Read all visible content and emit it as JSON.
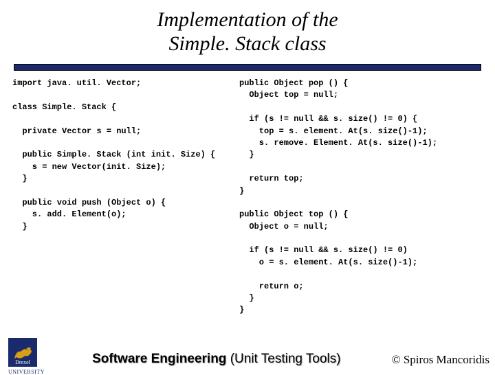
{
  "title_line1": "Implementation of the",
  "title_line2": "Simple. Stack class",
  "code_left": "import java. util. Vector;\n\nclass Simple. Stack {\n\n  private Vector s = null;\n\n  public Simple. Stack (int init. Size) {\n    s = new Vector(init. Size);\n  }\n\n  public void push (Object o) {\n    s. add. Element(o);\n  }",
  "code_right": "public Object pop () {\n  Object top = null;\n\n  if (s != null && s. size() != 0) {\n    top = s. element. At(s. size()-1);\n    s. remove. Element. At(s. size()-1);\n  }\n\n  return top;\n}\n\npublic Object top () {\n  Object o = null;\n\n  if (s != null && s. size() != 0)\n    o = s. element. At(s. size()-1);\n\n    return o;\n  }\n}",
  "logo": {
    "school": "Drexel",
    "sub": "UNIVERSITY"
  },
  "footer_main_bold": "Software Engineering ",
  "footer_main_rest": "(Unit Testing Tools)",
  "copyright": "© Spiros Mancoridis"
}
